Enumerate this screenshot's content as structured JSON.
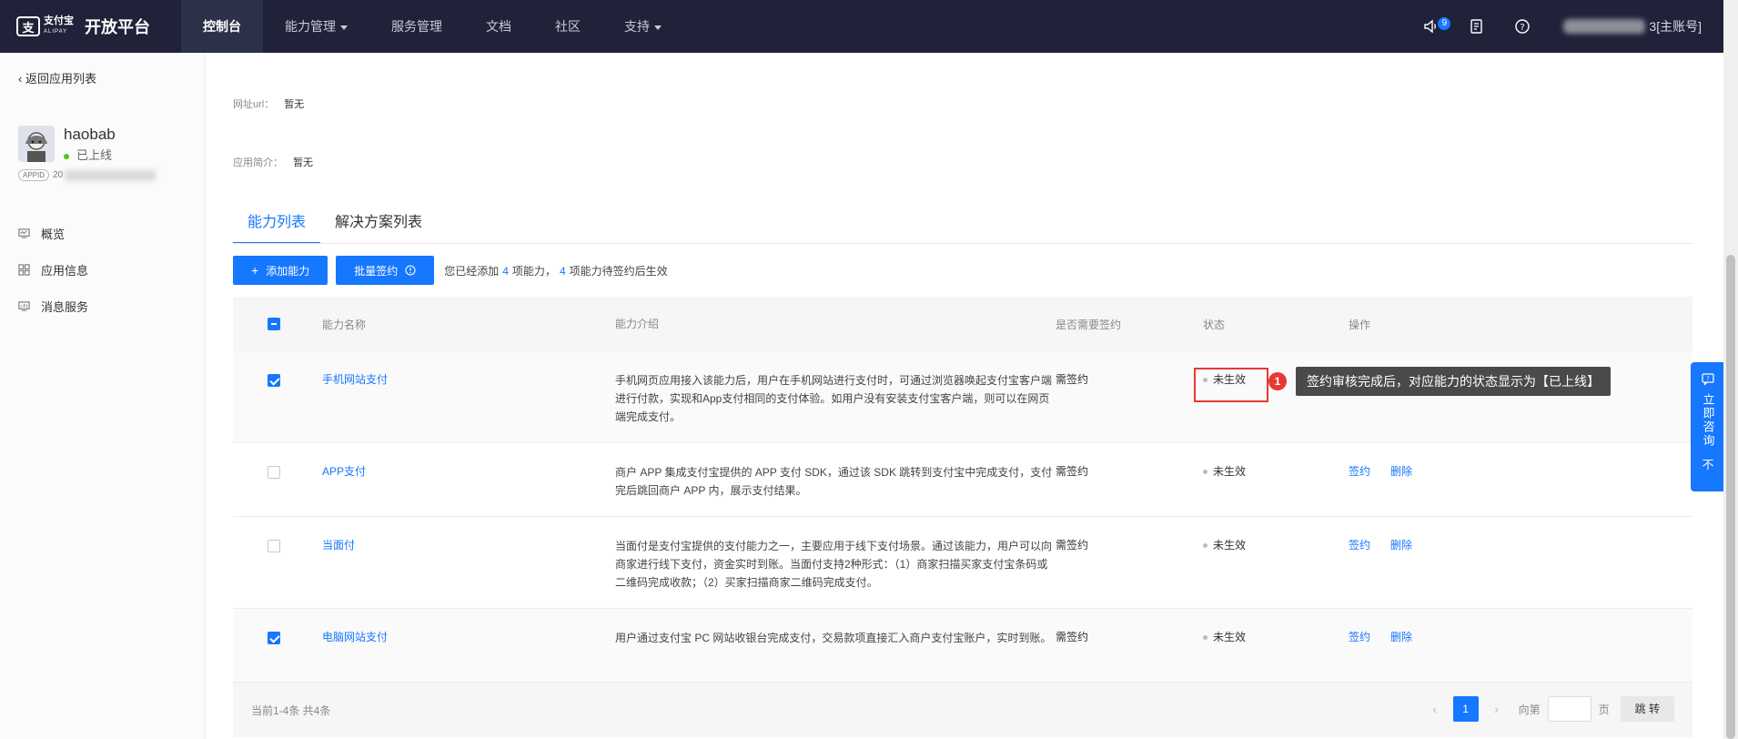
{
  "topbar": {
    "logo_cn": "支付宝",
    "logo_en": "ALIPAY",
    "platform_title": "开放平台",
    "nav": [
      {
        "label": "控制台",
        "active": true,
        "dropdown": false
      },
      {
        "label": "能力管理",
        "active": false,
        "dropdown": true
      },
      {
        "label": "服务管理",
        "active": false,
        "dropdown": false
      },
      {
        "label": "文档",
        "active": false,
        "dropdown": false
      },
      {
        "label": "社区",
        "active": false,
        "dropdown": false
      },
      {
        "label": "支持",
        "active": false,
        "dropdown": true
      }
    ],
    "notifications_count": "9",
    "user_suffix": "3[主账号]"
  },
  "sidebar": {
    "back_label": "返回应用列表",
    "app_name": "haobab",
    "app_status": "已上线",
    "appid_tag": "APPID",
    "appid_prefix": "20",
    "menu": [
      "概览",
      "应用信息",
      "消息服务"
    ]
  },
  "main": {
    "url_label": "网址url：",
    "url_value": "暂无",
    "intro_label": "应用简介：",
    "intro_value": "暂无",
    "tabs": [
      "能力列表",
      "解决方案列表"
    ],
    "add_button": "添加能力",
    "batch_button": "批量签约",
    "summary_prefix": "您已经添加",
    "summary_count1": "4",
    "summary_mid": "项能力，",
    "summary_count2": "4",
    "summary_suffix": "项能力待签约后生效",
    "table": {
      "headers": [
        "能力名称",
        "能力介绍",
        "是否需要签约",
        "状态",
        "操作"
      ],
      "rows": [
        {
          "checked": true,
          "name": "手机网站支付",
          "desc": "手机网页应用接入该能力后，用户在手机网站进行支付时，可通过浏览器唤起支付宝客户端进行付款，实现和App支付相同的支付体验。如用户没有安装支付宝客户端，则可以在网页端完成支付。",
          "sign": "需签约",
          "status": "未生效",
          "op_sign": "",
          "op_delete": ""
        },
        {
          "checked": false,
          "name": "APP支付",
          "desc": "商户 APP 集成支付宝提供的 APP 支付 SDK，通过该 SDK 跳转到支付宝中完成支付，支付完后跳回商户 APP 内，展示支付结果。",
          "sign": "需签约",
          "status": "未生效",
          "op_sign": "签约",
          "op_delete": "删除"
        },
        {
          "checked": false,
          "name": "当面付",
          "desc": "当面付是支付宝提供的支付能力之一，主要应用于线下支付场景。通过该能力，用户可以向商家进行线下支付，资金实时到账。当面付支持2种形式：（1）商家扫描买家支付宝条码或二维码完成收款；（2）买家扫描商家二维码完成支付。",
          "sign": "需签约",
          "status": "未生效",
          "op_sign": "签约",
          "op_delete": "删除"
        },
        {
          "checked": true,
          "name": "电脑网站支付",
          "desc": "用户通过支付宝 PC 网站收银台完成支付，交易款项直接汇入商户支付宝账户，实时到账。",
          "sign": "需签约",
          "status": "未生效",
          "op_sign": "签约",
          "op_delete": "删除"
        }
      ]
    },
    "footer_text": "当前1-4条 共4条",
    "pager": {
      "current_page": "1",
      "goto_label": "向第",
      "page_unit": "页",
      "jump_button": "跳 转"
    }
  },
  "callout": {
    "number": "1",
    "text": "签约审核完成后，对应能力的状态显示为【已上线】"
  },
  "float_consult": {
    "label": "立即咨询",
    "icon_text": "不"
  }
}
